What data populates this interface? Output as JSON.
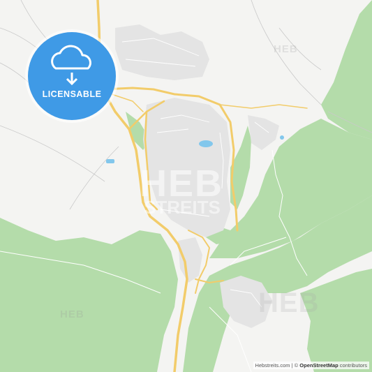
{
  "badge": {
    "label": "LICENSABLE",
    "icon": "cloud-download-icon",
    "color": "#3f9ae6"
  },
  "watermarks": {
    "small": [
      "HEB",
      "HEB",
      "HEB"
    ],
    "main": "HEB",
    "streits": "STREITS"
  },
  "attribution": {
    "site": "Hebstreits.com",
    "separator": " | © ",
    "osm": "OpenStreetMap",
    "suffix": " contributors"
  },
  "colors": {
    "background": "#f4f4f2",
    "forest": "#a8d8a0",
    "road": "#f3d27a",
    "water": "#7cc3ea",
    "urban": "#e6e6e6"
  }
}
